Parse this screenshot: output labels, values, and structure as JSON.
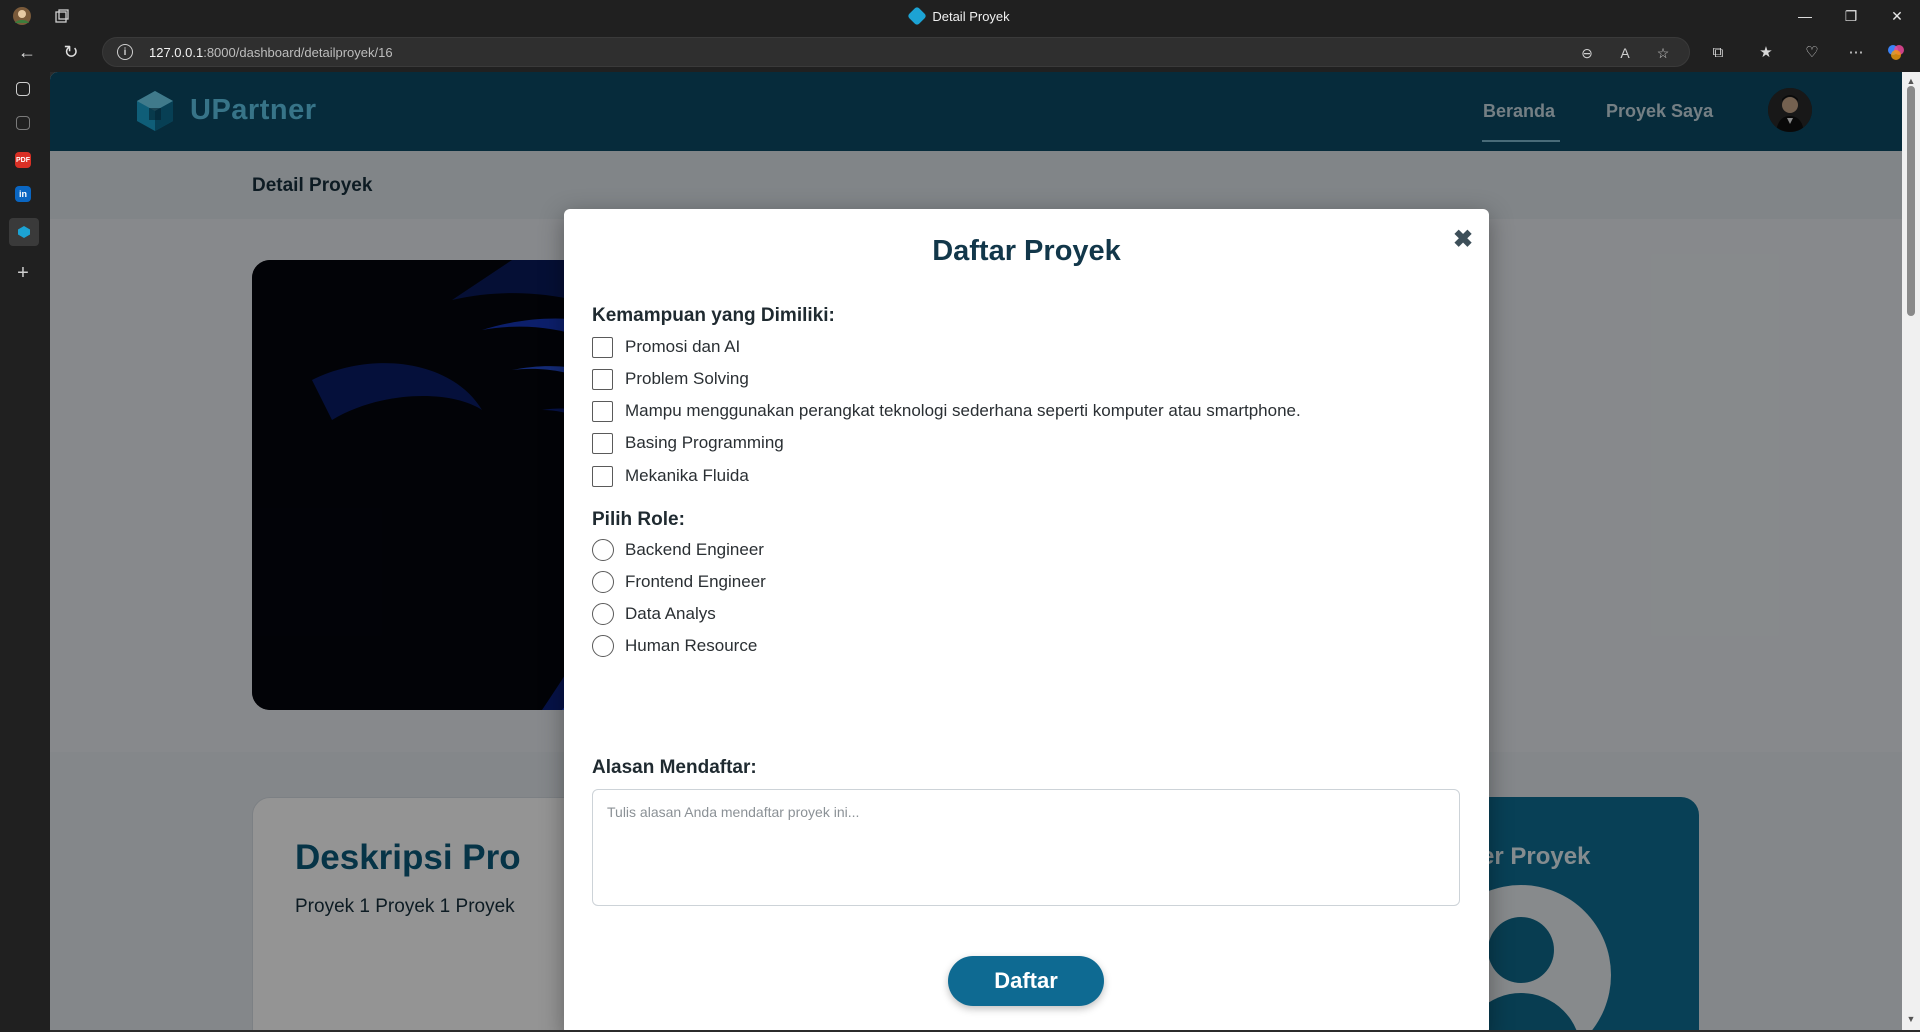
{
  "browser": {
    "window_title": "Detail Proyek",
    "url_host": "127.0.0.1",
    "url_rest": ":8000/dashboard/detailproyek/16"
  },
  "site": {
    "brand": "UPartner",
    "nav": {
      "home": "Beranda",
      "my_projects": "Proyek Saya"
    },
    "page_heading": "Detail Proyek",
    "description_heading": "Deskripsi Pro",
    "description_text": "Proyek 1 Proyek 1 Proyek",
    "manager_heading": "Manajer Proyek",
    "side_fragment": "!"
  },
  "modal": {
    "title": "Daftar Proyek",
    "close_glyph": "✖",
    "skills_label": "Kemampuan yang Dimiliki:",
    "skills": [
      "Promosi dan AI",
      "Problem Solving",
      "Mampu menggunakan perangkat teknologi sederhana seperti komputer atau smartphone.",
      "Basing Programming",
      "Mekanika Fluida"
    ],
    "role_label": "Pilih Role:",
    "roles": [
      "Backend Engineer",
      "Frontend Engineer",
      "Data Analys",
      "Human Resource"
    ],
    "reason_label": "Alasan Mendaftar:",
    "reason_placeholder": "Tulis alasan Anda mendaftar proyek ini...",
    "reason_value": "",
    "submit_label": "Daftar"
  },
  "colors": {
    "header": "#0b4a66",
    "accent": "#0e6a92",
    "brand_text": "#5fc9ea",
    "modal_title": "#12374a"
  }
}
